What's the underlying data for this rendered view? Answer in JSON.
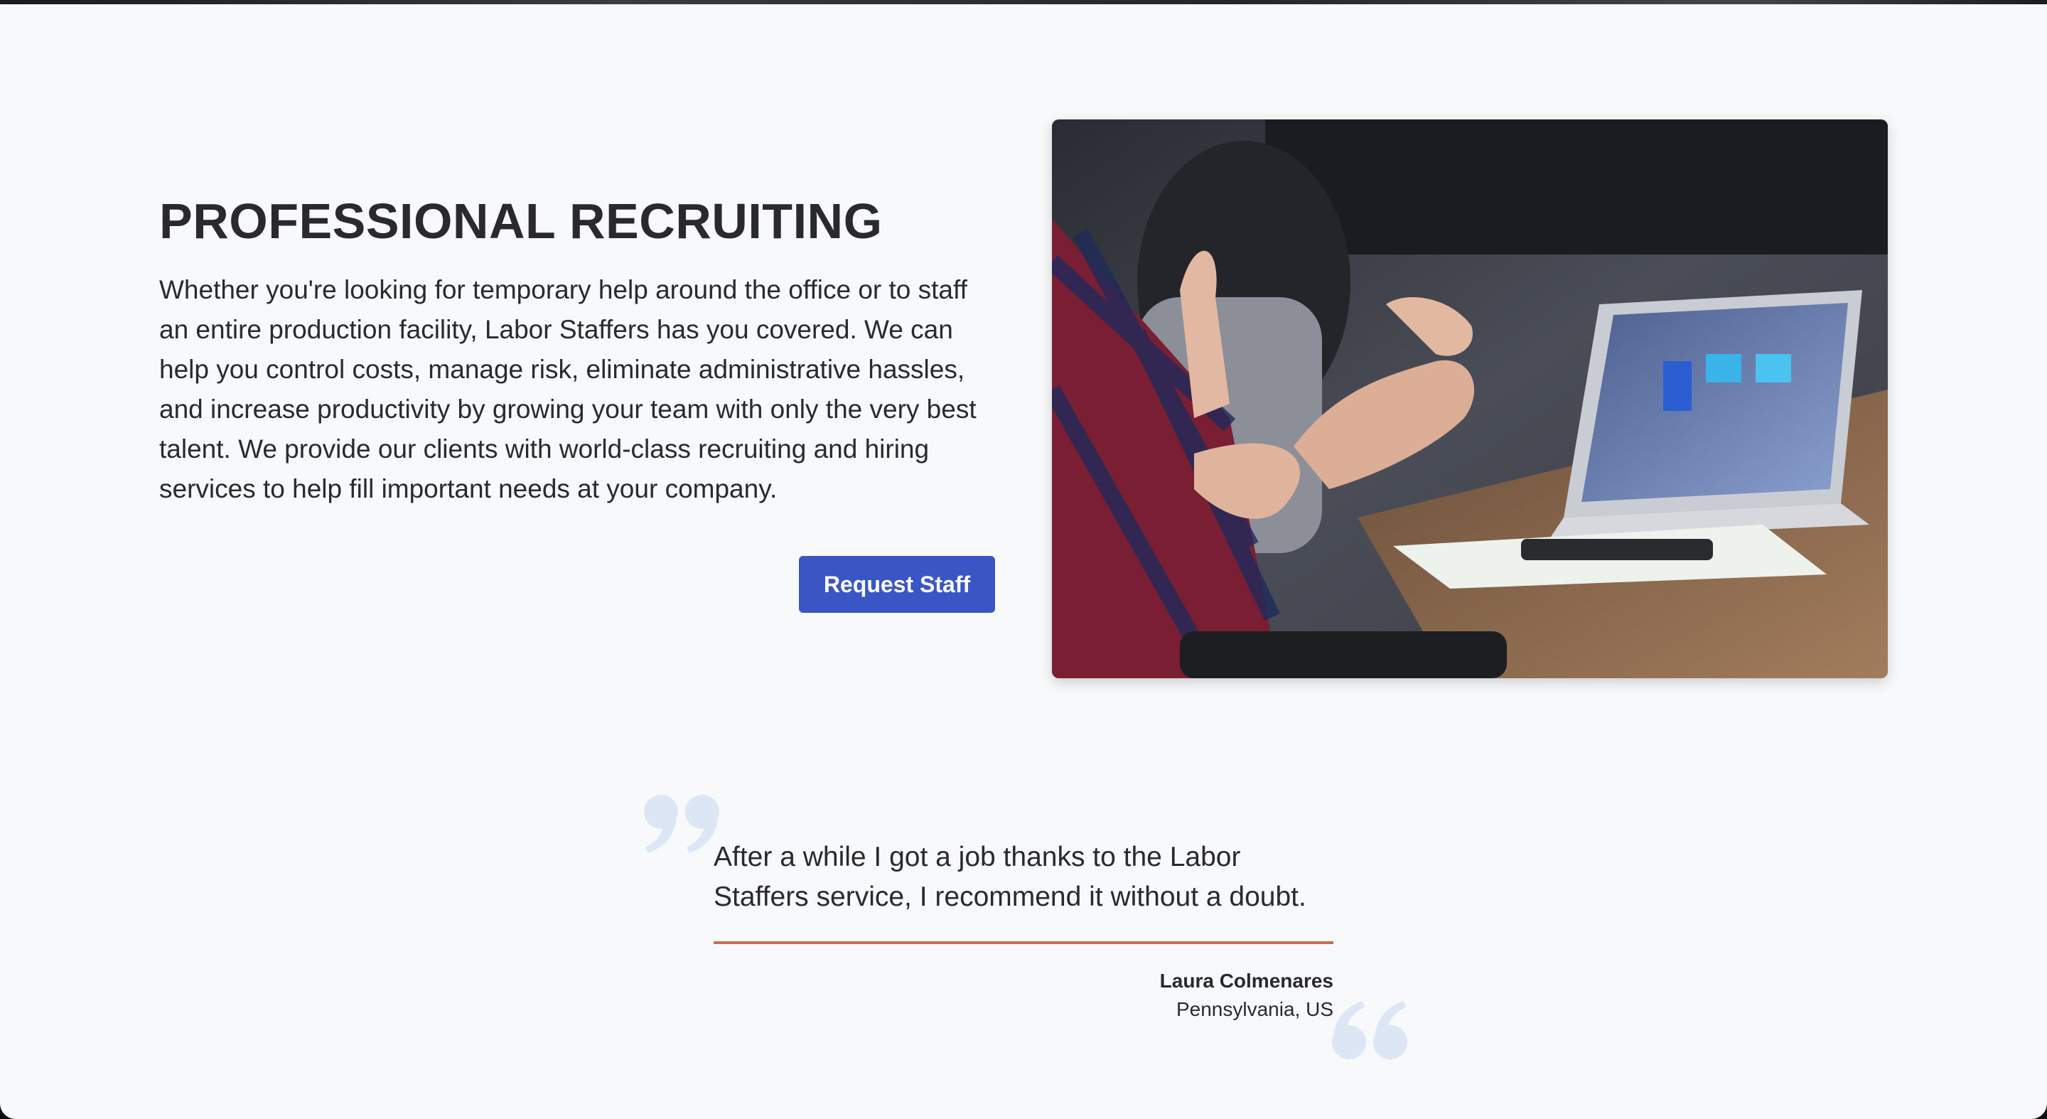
{
  "hero": {
    "title": "PROFESSIONAL RECRUITING",
    "body": "Whether you're looking for temporary help around the office or to staff an entire production facility, Labor Staffers has you covered. We can help you control costs, manage risk, eliminate administrative hassles, and increase productivity by growing your team with only the very best talent. We provide our clients with world-class recruiting and hiring services to help fill important needs at your company.",
    "cta_label": "Request Staff",
    "cta_color": "#3a55c4"
  },
  "testimonial": {
    "quote": "After a while I got a job thanks to the Labor Staffers service, I recommend it without a doubt.",
    "author": "Laura Colmenares",
    "location": "Pennsylvania, US",
    "accent_color": "#c8704e",
    "quote_icon_color": "#dde6f5"
  },
  "icons": {
    "open_quote": "closing-quote-mark-icon",
    "close_quote": "opening-quote-mark-icon"
  }
}
